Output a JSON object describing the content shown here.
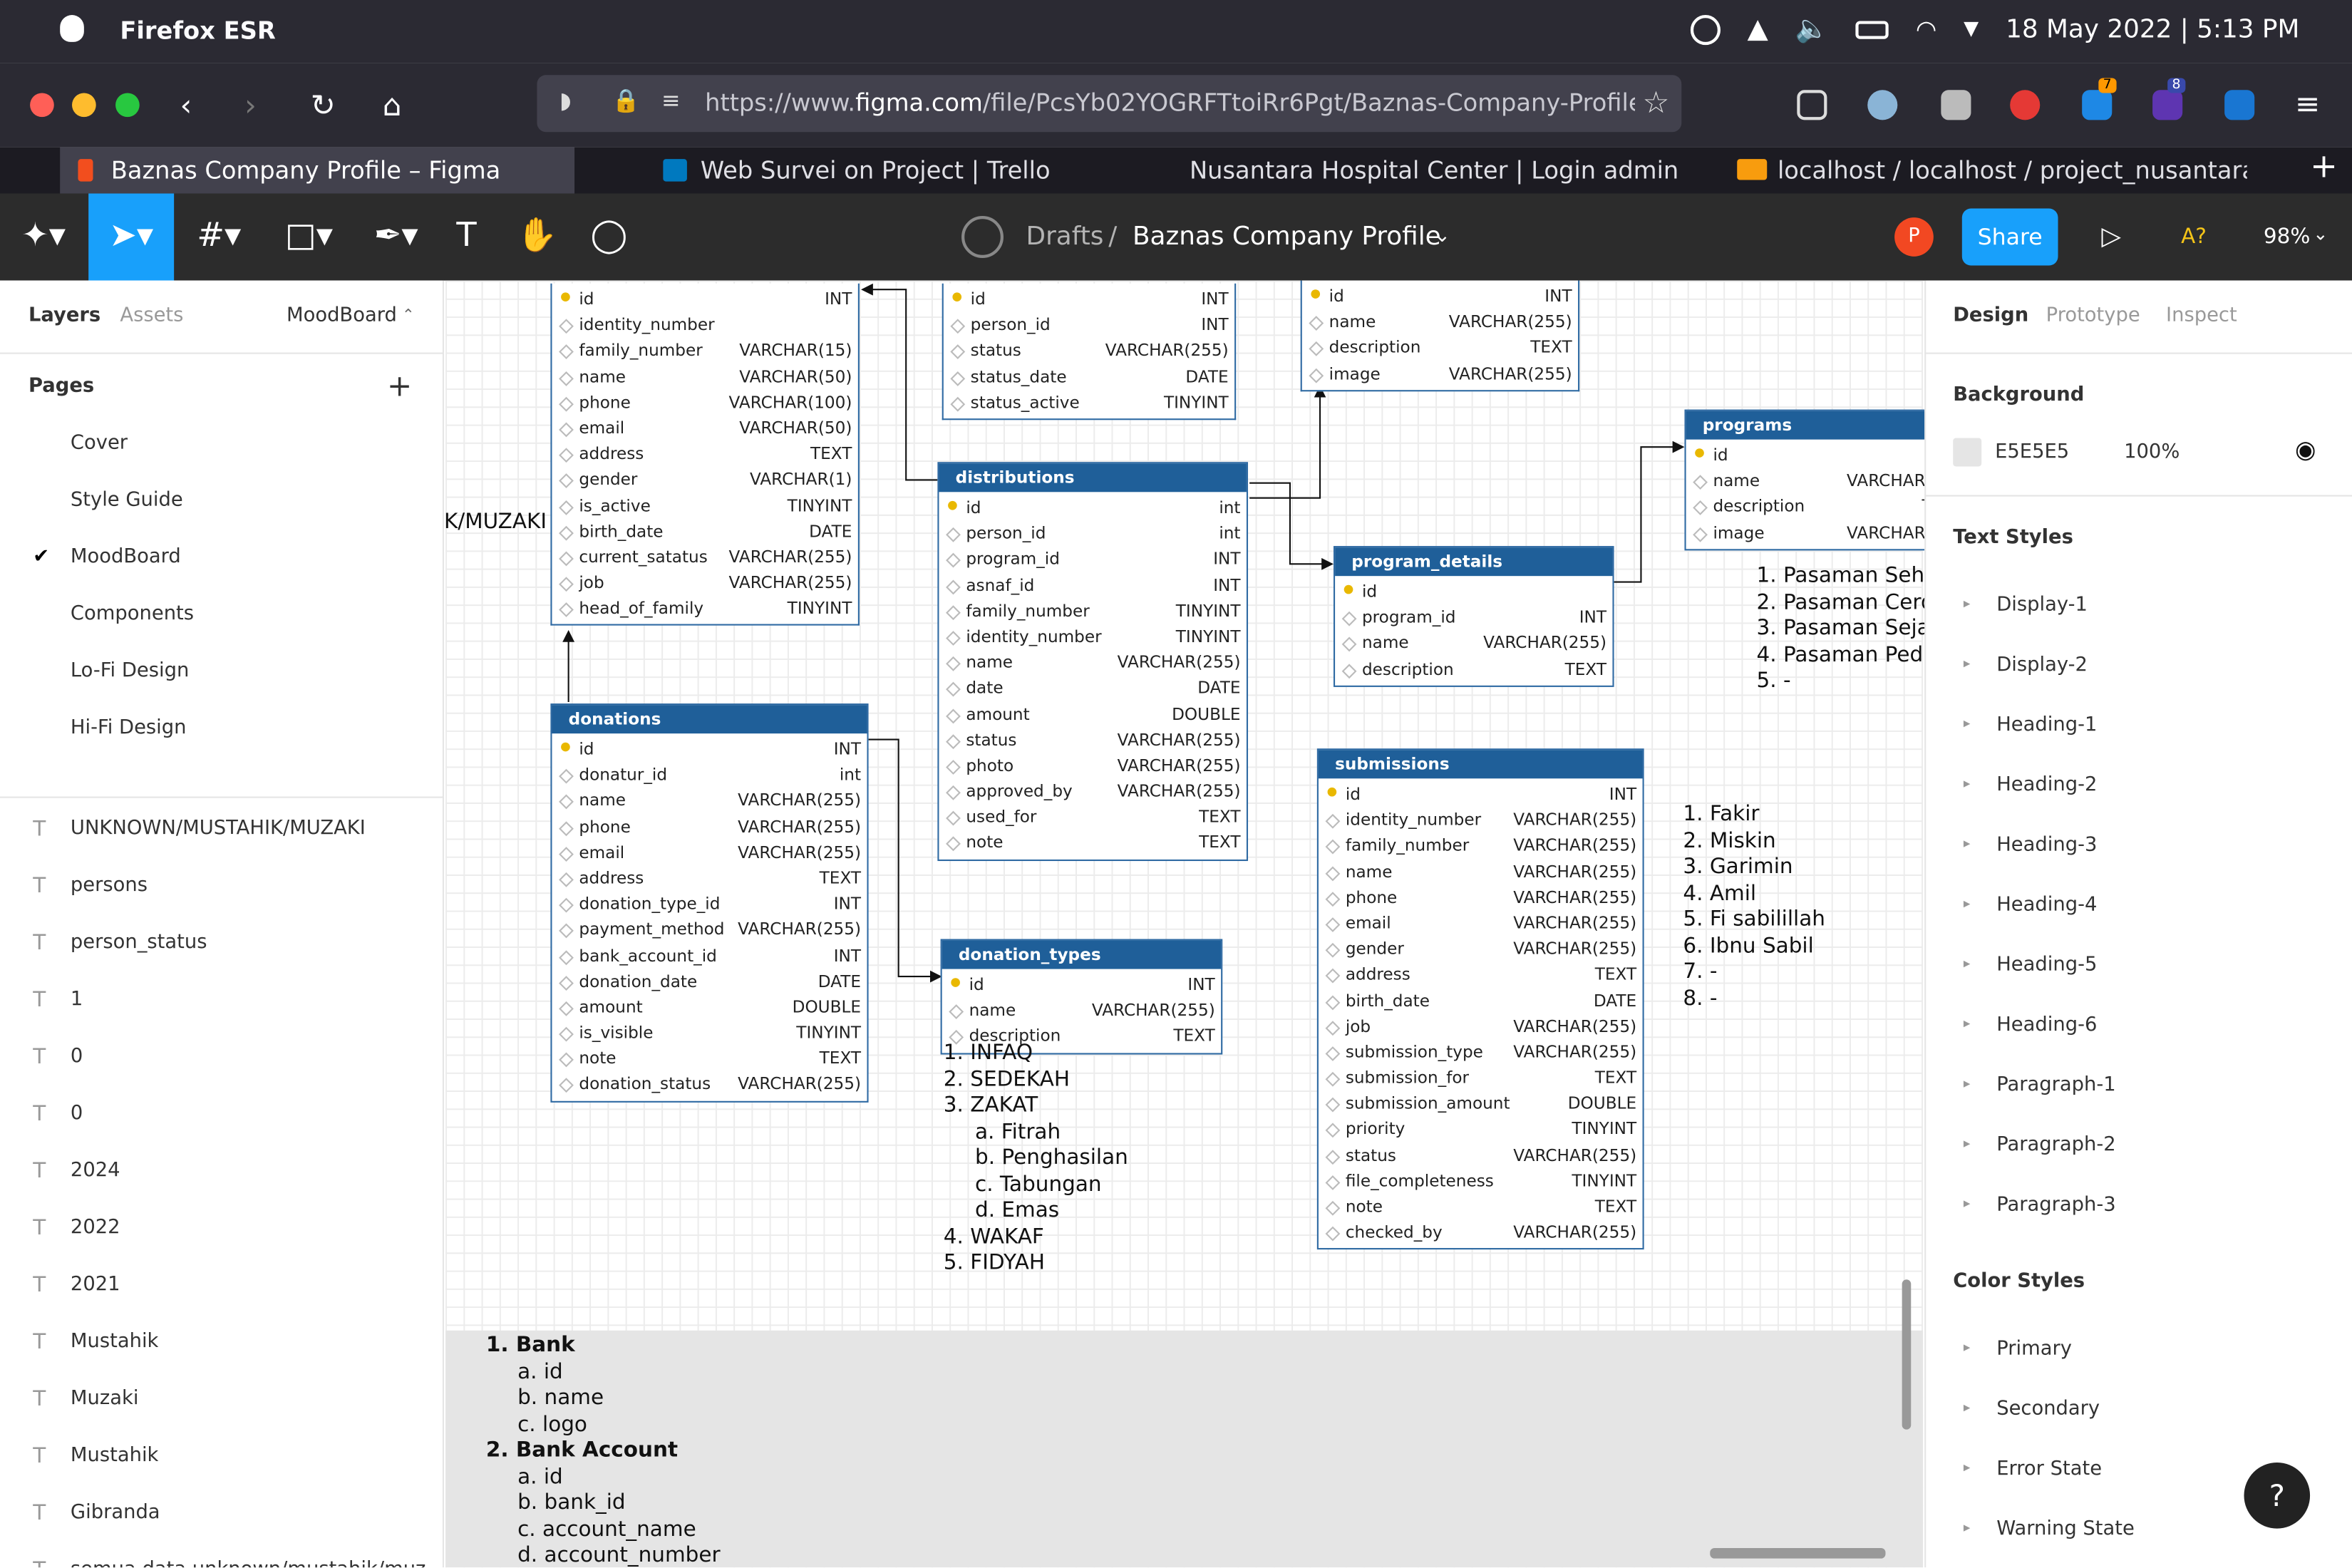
{
  "os": {
    "app_name": "Firefox ESR",
    "clock": "18 May 2022 | 5:13 PM"
  },
  "browser": {
    "url_prefix": "https://www.",
    "url_domain": "figma.com",
    "url_rest": "/file/PcsYb02YOGRFTtoiRr6Pgt/Baznas-Company-Profile?",
    "tabs": [
      {
        "label": "Baznas Company Profile – Figma"
      },
      {
        "label": "Web Survei on Project | Trello"
      },
      {
        "label": "Nusantara Hospital Center | Login admin"
      },
      {
        "label": "localhost / localhost / project_nusantarahospital"
      }
    ],
    "badges": [
      "7",
      "8"
    ]
  },
  "figma": {
    "crumb": "Drafts",
    "separator": "/",
    "file_title": "Baznas Company Profile",
    "avatar_letter": "P",
    "share": "Share",
    "zoom": "98%",
    "present_hint": "A?"
  },
  "left": {
    "tab_layers": "Layers",
    "tab_assets": "Assets",
    "current_page_dropdown": "MoodBoard",
    "pages_heading": "Pages",
    "add": "+",
    "pages": [
      "Cover",
      "Style Guide",
      "MoodBoard",
      "Components",
      "Lo-Fi Design",
      "Hi-Fi Design"
    ],
    "layers": [
      "UNKNOWN/MUSTAHIK/MUZAKI",
      "persons",
      "person_status",
      "1",
      "0",
      "0",
      "2024",
      "2022",
      "2021",
      "Mustahik",
      "Muzaki",
      "Mustahik",
      "Gibranda",
      "semua data unknown/mustahik/muz"
    ]
  },
  "right": {
    "tabs": [
      "Design",
      "Prototype",
      "Inspect"
    ],
    "background_heading": "Background",
    "bg_hex": "E5E5E5",
    "bg_opacity": "100%",
    "text_styles_heading": "Text Styles",
    "text_styles": [
      "Display-1",
      "Display-2",
      "Heading-1",
      "Heading-2",
      "Heading-3",
      "Heading-4",
      "Heading-5",
      "Heading-6",
      "Paragraph-1",
      "Paragraph-2",
      "Paragraph-3"
    ],
    "color_styles_heading": "Color Styles",
    "color_styles": [
      "Primary",
      "Secondary",
      "Error State",
      "Warning State"
    ],
    "help": "?"
  },
  "canvas": {
    "fragment_label": "K/MUZAKI",
    "tables": [
      {
        "name": "",
        "rows": [
          [
            "id",
            "INT",
            true
          ],
          [
            "identity_number",
            "",
            false
          ],
          [
            "family_number",
            "VARCHAR(15)",
            false
          ],
          [
            "name",
            "VARCHAR(50)",
            false
          ],
          [
            "phone",
            "VARCHAR(100)",
            false
          ],
          [
            "email",
            "VARCHAR(50)",
            false
          ],
          [
            "address",
            "TEXT",
            false
          ],
          [
            "gender",
            "VARCHAR(1)",
            false
          ],
          [
            "is_active",
            "TINYINT",
            false
          ],
          [
            "birth_date",
            "DATE",
            false
          ],
          [
            "current_satatus",
            "VARCHAR(255)",
            false
          ],
          [
            "job",
            "VARCHAR(255)",
            false
          ],
          [
            "head_of_family",
            "TINYINT",
            false
          ]
        ]
      },
      {
        "name": "",
        "rows": [
          [
            "id",
            "INT",
            true
          ],
          [
            "person_id",
            "INT",
            false
          ],
          [
            "status",
            "VARCHAR(255)",
            false
          ],
          [
            "status_date",
            "DATE",
            false
          ],
          [
            "status_active",
            "TINYINT",
            false
          ]
        ]
      },
      {
        "name": "",
        "rows": [
          [
            "id",
            "INT",
            true
          ],
          [
            "name",
            "VARCHAR(255)",
            false
          ],
          [
            "description",
            "TEXT",
            false
          ],
          [
            "image",
            "VARCHAR(255)",
            false
          ]
        ]
      },
      {
        "name": "programs",
        "rows": [
          [
            "id",
            "",
            true
          ],
          [
            "name",
            "VARCHAR(",
            false
          ],
          [
            "description",
            "T",
            false
          ],
          [
            "image",
            "VARCHAR(",
            false
          ]
        ]
      },
      {
        "name": "distributions",
        "rows": [
          [
            "id",
            "int",
            true
          ],
          [
            "person_id",
            "int",
            false
          ],
          [
            "program_id",
            "INT",
            false
          ],
          [
            "asnaf_id",
            "INT",
            false
          ],
          [
            "family_number",
            "TINYINT",
            false
          ],
          [
            "identity_number",
            "TINYINT",
            false
          ],
          [
            "name",
            "VARCHAR(255)",
            false
          ],
          [
            "date",
            "DATE",
            false
          ],
          [
            "amount",
            "DOUBLE",
            false
          ],
          [
            "status",
            "VARCHAR(255)",
            false
          ],
          [
            "photo",
            "VARCHAR(255)",
            false
          ],
          [
            "approved_by",
            "VARCHAR(255)",
            false
          ],
          [
            "used_for",
            "TEXT",
            false
          ],
          [
            "note",
            "TEXT",
            false
          ]
        ]
      },
      {
        "name": "program_details",
        "rows": [
          [
            "id",
            "",
            true
          ],
          [
            "program_id",
            "INT",
            false
          ],
          [
            "name",
            "VARCHAR(255)",
            false
          ],
          [
            "description",
            "TEXT",
            false
          ]
        ]
      },
      {
        "name": "donations",
        "rows": [
          [
            "id",
            "INT",
            true
          ],
          [
            "donatur_id",
            "int",
            false
          ],
          [
            "name",
            "VARCHAR(255)",
            false
          ],
          [
            "phone",
            "VARCHAR(255)",
            false
          ],
          [
            "email",
            "VARCHAR(255)",
            false
          ],
          [
            "address",
            "TEXT",
            false
          ],
          [
            "donation_type_id",
            "INT",
            false
          ],
          [
            "payment_method",
            "VARCHAR(255)",
            false
          ],
          [
            "bank_account_id",
            "INT",
            false
          ],
          [
            "donation_date",
            "DATE",
            false
          ],
          [
            "amount",
            "DOUBLE",
            false
          ],
          [
            "is_visible",
            "TINYINT",
            false
          ],
          [
            "note",
            "TEXT",
            false
          ],
          [
            "donation_status",
            "VARCHAR(255)",
            false
          ]
        ]
      },
      {
        "name": "donation_types",
        "rows": [
          [
            "id",
            "INT",
            true
          ],
          [
            "name",
            "VARCHAR(255)",
            false
          ],
          [
            "description",
            "TEXT",
            false
          ]
        ]
      },
      {
        "name": "submissions",
        "rows": [
          [
            "id",
            "INT",
            true
          ],
          [
            "identity_number",
            "VARCHAR(255)",
            false
          ],
          [
            "family_number",
            "VARCHAR(255)",
            false
          ],
          [
            "name",
            "VARCHAR(255)",
            false
          ],
          [
            "phone",
            "VARCHAR(255)",
            false
          ],
          [
            "email",
            "VARCHAR(255)",
            false
          ],
          [
            "gender",
            "VARCHAR(255)",
            false
          ],
          [
            "address",
            "TEXT",
            false
          ],
          [
            "birth_date",
            "DATE",
            false
          ],
          [
            "job",
            "VARCHAR(255)",
            false
          ],
          [
            "submission_type",
            "VARCHAR(255)",
            false
          ],
          [
            "submission_for",
            "TEXT",
            false
          ],
          [
            "submission_amount",
            "DOUBLE",
            false
          ],
          [
            "priority",
            "TINYINT",
            false
          ],
          [
            "status",
            "VARCHAR(255)",
            false
          ],
          [
            "file_completeness",
            "TINYINT",
            false
          ],
          [
            "note",
            "TEXT",
            false
          ],
          [
            "checked_by",
            "VARCHAR(255)",
            false
          ]
        ]
      }
    ],
    "programs_list": [
      "1. Pasaman Seha",
      "2. Pasaman Cerd",
      "3. Pasaman Sejal",
      "4. Pasaman Pedu",
      "5. -"
    ],
    "asnaf_list": [
      "1. Fakir",
      "2. Miskin",
      "3. Garimin",
      "4. Amil",
      "5. Fi sabilillah",
      "6. Ibnu Sabil",
      "7. -",
      "8. -"
    ],
    "donation_list": [
      "1. INFAQ",
      "2. SEDEKAH",
      "3. ZAKAT",
      "a. Fitrah",
      "b. Penghasilan",
      "c. Tabungan",
      "d. Emas",
      "4. WAKAF",
      "5. FIDYAH"
    ],
    "bank_list": [
      "1. Bank",
      "a. id",
      "b. name",
      "c. logo",
      "2. Bank Account",
      "a. id",
      "b. bank_id",
      "c. account_name",
      "d. account_number"
    ]
  }
}
